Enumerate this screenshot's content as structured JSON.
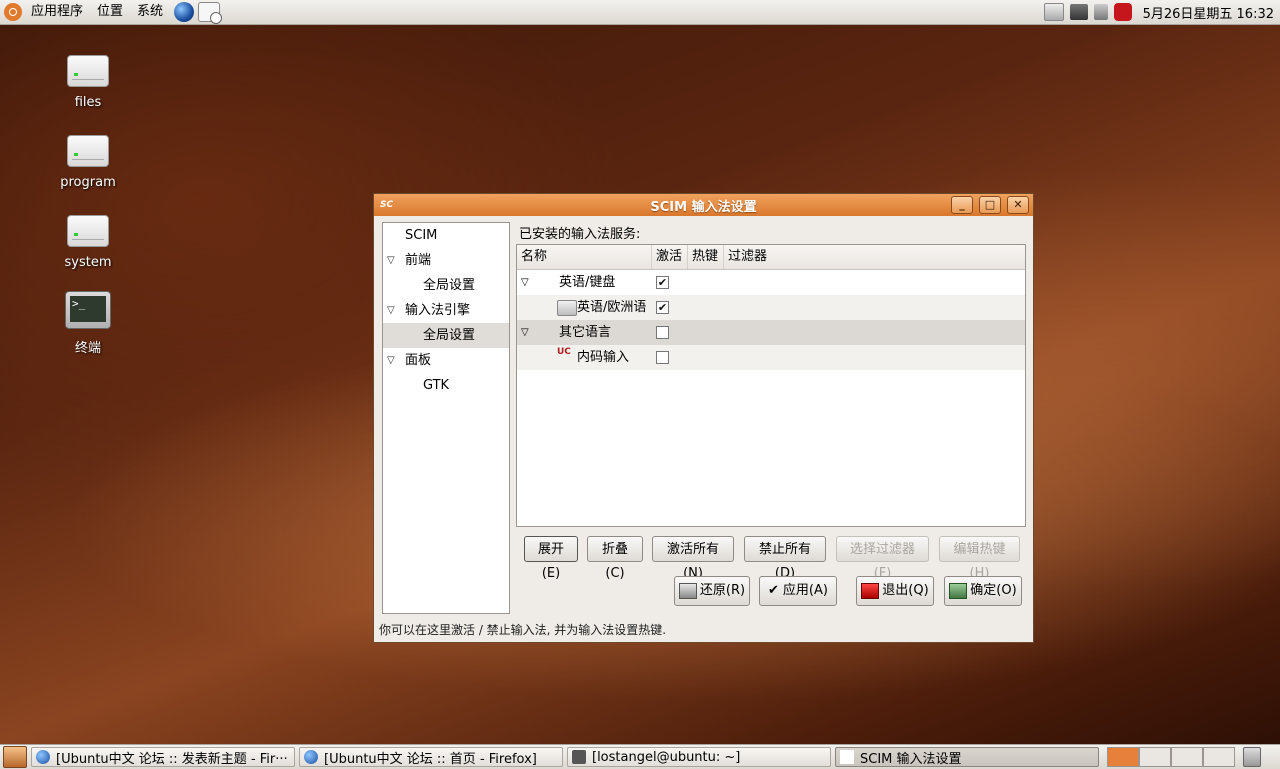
{
  "top_panel": {
    "menus": [
      "应用程序",
      "位置",
      "系统"
    ],
    "clock": "5月26日星期五 16:32"
  },
  "desktop": {
    "icons": [
      {
        "label": "files",
        "icon": "drive-icon"
      },
      {
        "label": "program",
        "icon": "drive-icon"
      },
      {
        "label": "system",
        "icon": "drive-icon"
      },
      {
        "label": "终端",
        "icon": "terminal-icon",
        "glyph": ">_"
      }
    ]
  },
  "window": {
    "title": "SCIM 输入法设置",
    "controls": {
      "minimize": "_",
      "maximize": "□",
      "close": "✕"
    },
    "nav": [
      {
        "label": "SCIM"
      },
      {
        "label": "前端"
      },
      {
        "label": "全局设置"
      },
      {
        "label": "输入法引擎"
      },
      {
        "label": "全局设置"
      },
      {
        "label": "面板"
      },
      {
        "label": "GTK"
      }
    ],
    "installed_label": "已安装的输入法服务:",
    "table": {
      "headers": [
        "名称",
        "激活",
        "热键",
        "过滤器"
      ],
      "rows": [
        {
          "name": "英语/键盘",
          "active": "✔"
        },
        {
          "name": "英语/欧洲语",
          "active": "✔"
        },
        {
          "name": "其它语言",
          "active": ""
        },
        {
          "name": "内码输入",
          "active": ""
        }
      ],
      "raw_icon_text": "UC"
    },
    "buttons": {
      "expand": "展开(E)",
      "collapse": "折叠(C)",
      "activate_all": "激活所有(N)",
      "disable_all": "禁止所有(D)",
      "select_filter": "选择过滤器(F)",
      "edit_hotkey": "编辑热键(H)",
      "revert": "还原(R)",
      "apply": "应用(A)",
      "quit": "退出(Q)",
      "ok": "确定(O)"
    },
    "status": "你可以在这里激活 / 禁止输入法, 并为输入法设置热键."
  },
  "bottom_panel": {
    "tasks": [
      {
        "label": "[Ubuntu中文 论坛 :: 发表新主题 - Fir···",
        "icon": "firefox-icon"
      },
      {
        "label": "[Ubuntu中文 论坛 :: 首页 - Firefox]",
        "icon": "firefox-icon"
      },
      {
        "label": "[lostangel@ubuntu: ~]",
        "icon": "terminal-icon"
      },
      {
        "label": "SCIM 输入法设置",
        "icon": "scim-icon"
      }
    ]
  },
  "colors": {
    "title_orange": "#d9772c",
    "selection": "#dcd8d3"
  }
}
